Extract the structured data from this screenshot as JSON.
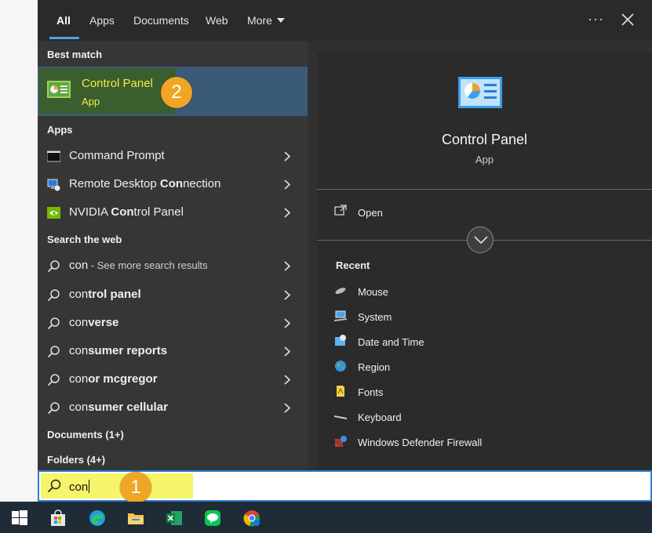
{
  "nav": {
    "tabs": [
      {
        "label": "All",
        "active": true
      },
      {
        "label": "Apps"
      },
      {
        "label": "Documents"
      },
      {
        "label": "Web"
      },
      {
        "label": "More"
      }
    ],
    "more_icon": "ellipsis-icon",
    "close_icon": "close-icon"
  },
  "best_match": {
    "heading": "Best match",
    "title": "Control Panel",
    "subtitle": "App",
    "icon": "control-panel-icon",
    "badge": "2"
  },
  "apps": {
    "heading": "Apps",
    "items": [
      {
        "label_pre": "",
        "label_bold": "",
        "label_post": "Command Prompt",
        "icon": "terminal-icon"
      },
      {
        "label_pre": "Remote Desktop ",
        "label_bold": "Con",
        "label_post": "nection",
        "icon": "remote-desktop-icon"
      },
      {
        "label_pre": "NVIDIA ",
        "label_bold": "Con",
        "label_post": "trol Panel",
        "icon": "nvidia-icon"
      }
    ]
  },
  "web": {
    "heading": "Search the web",
    "items": [
      {
        "label_pre": "con",
        "label_bold": "",
        "label_post": "",
        "label_suffix": " - See more search results"
      },
      {
        "label_pre": "con",
        "label_bold": "trol panel",
        "label_post": "",
        "label_suffix": ""
      },
      {
        "label_pre": "con",
        "label_bold": "verse",
        "label_post": "",
        "label_suffix": ""
      },
      {
        "label_pre": "con",
        "label_bold": "sumer reports",
        "label_post": "",
        "label_suffix": ""
      },
      {
        "label_pre": "con",
        "label_bold": "or mcgregor",
        "label_post": "",
        "label_suffix": ""
      },
      {
        "label_pre": "con",
        "label_bold": "sumer cellular",
        "label_post": "",
        "label_suffix": ""
      }
    ]
  },
  "documents_heading": "Documents (1+)",
  "folders_heading": "Folders (4+)",
  "preview": {
    "title": "Control Panel",
    "subtitle": "App",
    "open_label": "Open",
    "recent_heading": "Recent",
    "recent": [
      {
        "label": "Mouse",
        "icon": "mouse-icon"
      },
      {
        "label": "System",
        "icon": "system-icon"
      },
      {
        "label": "Date and Time",
        "icon": "date-time-icon"
      },
      {
        "label": "Region",
        "icon": "globe-icon"
      },
      {
        "label": "Fonts",
        "icon": "fonts-icon"
      },
      {
        "label": "Keyboard",
        "icon": "keyboard-icon"
      },
      {
        "label": "Windows Defender Firewall",
        "icon": "firewall-icon"
      }
    ]
  },
  "search": {
    "value": "con",
    "badge": "1"
  },
  "taskbar": {
    "icons": [
      "windows-start-icon",
      "microsoft-store-icon",
      "edge-icon",
      "file-explorer-icon",
      "excel-icon",
      "line-icon",
      "chrome-icon"
    ]
  },
  "colors": {
    "accent": "#4fa3e6",
    "highlight_yellow": "#f6f46a",
    "badge_orange": "#f0a524",
    "selection_blue": "#3b5a78"
  }
}
